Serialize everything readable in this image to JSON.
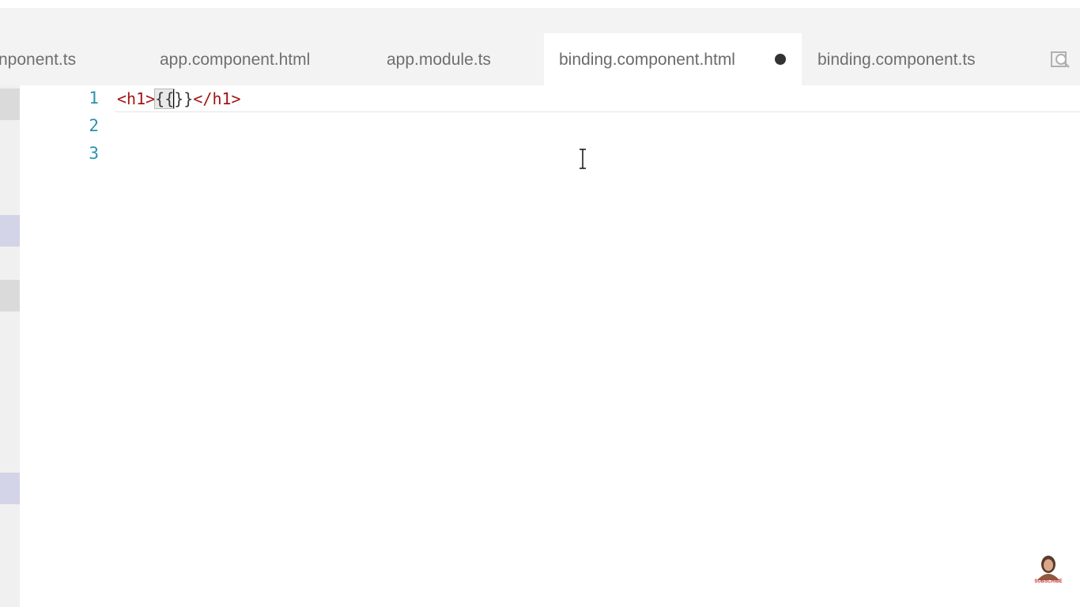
{
  "tabs": [
    {
      "label": "nponent.ts",
      "active": false
    },
    {
      "label": "app.component.html",
      "active": false
    },
    {
      "label": "app.module.ts",
      "active": false
    },
    {
      "label": "binding.component.html",
      "active": true,
      "dirty": true
    },
    {
      "label": "binding.component.ts",
      "active": false
    }
  ],
  "tab_actions": {
    "icon": "open-changes-icon"
  },
  "editor": {
    "line_numbers": [
      "1",
      "2",
      "3"
    ],
    "line1": {
      "open_tag": "<h1>",
      "open_braces": "{{",
      "close_braces": "}}",
      "close_tag": "</h1>"
    }
  },
  "overlay": {
    "watermark_text": "SUBSCRIBE"
  },
  "colors": {
    "tag": "#a31515",
    "line_number": "#2b91af",
    "tabbar_bg": "#f3f3f3",
    "active_tab_bg": "#ffffff"
  }
}
